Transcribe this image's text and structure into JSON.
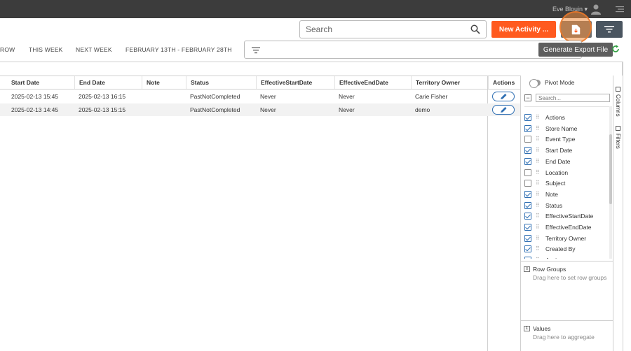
{
  "topbar": {
    "user_name": "Eve Blouin ▾",
    "user_icon": "user-avatar-icon",
    "menu_icon": "hamburger-menu-icon"
  },
  "search": {
    "placeholder": "Search",
    "icon": "search-icon"
  },
  "toolbar": {
    "new_activity_label": "New Activity ...",
    "export_icon": "file-export-icon",
    "filter_icon": "filter-icon",
    "tooltip": "Generate Export File",
    "accent_color": "#ff5a1f"
  },
  "day_tabs": [
    "ROW",
    "THIS WEEK",
    "NEXT WEEK",
    "FEBRUARY 13TH - FEBRUARY 28TH"
  ],
  "filter_bar": {
    "icon": "filter-lines-icon"
  },
  "grid": {
    "columns": [
      "Start Date",
      "End Date",
      "Note",
      "Status",
      "EffectiveStartDate",
      "EffectiveEndDate",
      "Territory Owner",
      "Actions"
    ],
    "rows": [
      {
        "start": "2025-02-13 15:45",
        "end": "2025-02-13 16:15",
        "note": "",
        "status": "PastNotCompleted",
        "eff_start": "Never",
        "eff_end": "Never",
        "owner": "Carie Fisher"
      },
      {
        "start": "2025-02-13 14:45",
        "end": "2025-02-13 15:15",
        "note": "",
        "status": "PastNotCompleted",
        "eff_start": "Never",
        "eff_end": "Never",
        "owner": "demo"
      }
    ]
  },
  "panel": {
    "pivot_label": "Pivot Mode",
    "search_placeholder": "Search...",
    "columns": [
      {
        "label": "Actions",
        "checked": true
      },
      {
        "label": "Store Name",
        "checked": true
      },
      {
        "label": "Event Type",
        "checked": false
      },
      {
        "label": "Start Date",
        "checked": true
      },
      {
        "label": "End Date",
        "checked": true
      },
      {
        "label": "Location",
        "checked": false
      },
      {
        "label": "Subject",
        "checked": false
      },
      {
        "label": "Note",
        "checked": true
      },
      {
        "label": "Status",
        "checked": true
      },
      {
        "label": "EffectiveStartDate",
        "checked": true
      },
      {
        "label": "EffectiveEndDate",
        "checked": true
      },
      {
        "label": "Territory Owner",
        "checked": true
      },
      {
        "label": "Created By",
        "checked": true
      },
      {
        "label": "Assignee",
        "checked": true
      }
    ],
    "row_groups": {
      "title": "Row Groups",
      "hint": "Drag here to set row groups"
    },
    "values": {
      "title": "Values",
      "hint": "Drag here to aggregate"
    }
  },
  "side_tabs": [
    "Columns",
    "Filters"
  ]
}
